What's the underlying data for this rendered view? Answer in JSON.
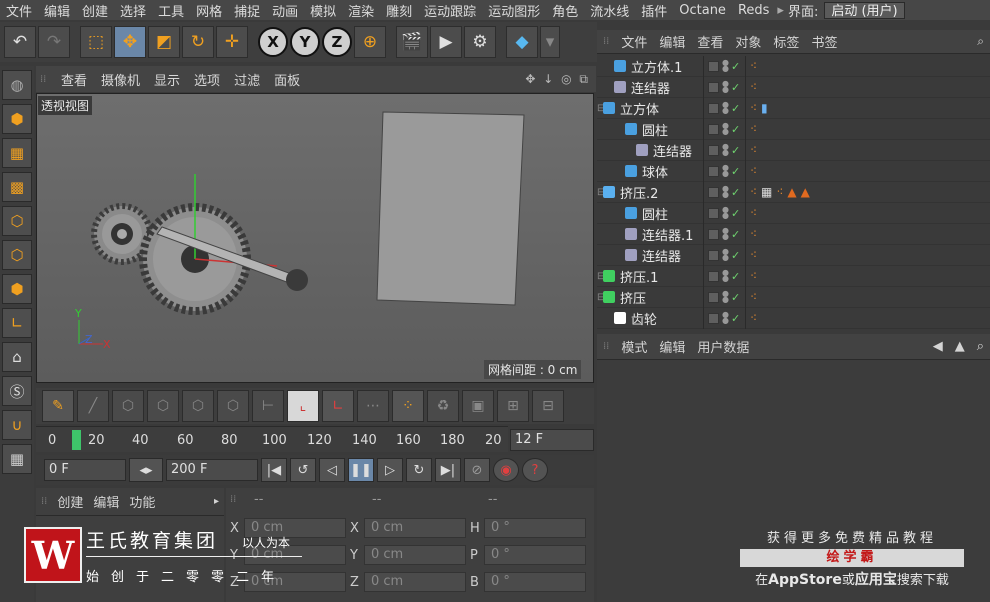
{
  "menubar": {
    "items": [
      "文件",
      "编辑",
      "创建",
      "选择",
      "工具",
      "网格",
      "捕捉",
      "动画",
      "模拟",
      "渲染",
      "雕刻",
      "运动跟踪",
      "运动图形",
      "角色",
      "流水线",
      "插件",
      "Octane",
      "Reds"
    ],
    "layout_label": "界面:",
    "layout_value": "启动 (用户)"
  },
  "toolbar": {
    "axis_x": "X",
    "axis_y": "Y",
    "axis_z": "Z"
  },
  "viewport": {
    "menu": [
      "查看",
      "摄像机",
      "显示",
      "选项",
      "过滤",
      "面板"
    ],
    "title": "透视视图",
    "grid_spacing": "网格间距 : 0 cm",
    "axis_y": "Y",
    "axis_z": "Z",
    "axis_x": "X"
  },
  "timeline": {
    "ticks": [
      "0",
      "20",
      "40",
      "60",
      "80",
      "100",
      "120",
      "140",
      "160",
      "180",
      "20"
    ],
    "current_frame": "12 F",
    "start_field": "0 F",
    "end_field": "200 F"
  },
  "materials": {
    "menu": [
      "创建",
      "编辑",
      "功能"
    ]
  },
  "coords": {
    "headers": [
      "--",
      "--",
      "--"
    ],
    "rows": [
      {
        "l1": "X",
        "v1": "0 cm",
        "l2": "X",
        "v2": "0 cm",
        "l3": "H",
        "v3": "0 °"
      },
      {
        "l1": "Y",
        "v1": "0 cm",
        "l2": "Y",
        "v2": "0 cm",
        "l3": "P",
        "v3": "0 °"
      },
      {
        "l1": "Z",
        "v1": "0 cm",
        "l2": "Z",
        "v2": "0 cm",
        "l3": "B",
        "v3": "0 °"
      }
    ]
  },
  "objects": {
    "menu": [
      "文件",
      "编辑",
      "查看",
      "对象",
      "标签",
      "书签"
    ],
    "rows": [
      {
        "name": "立方体.1",
        "color": "#4aa0e0",
        "indent": 1
      },
      {
        "name": "连结器",
        "color": "#a0a0c0",
        "indent": 1
      },
      {
        "name": "立方体",
        "color": "#4aa0e0",
        "indent": 0
      },
      {
        "name": "圆柱",
        "color": "#4aa0e0",
        "indent": 2
      },
      {
        "name": "连结器",
        "color": "#a0a0c0",
        "indent": 3
      },
      {
        "name": "球体",
        "color": "#4aa0e0",
        "indent": 2
      },
      {
        "name": "挤压.2",
        "color": "#5ab0f0",
        "indent": 0
      },
      {
        "name": "圆柱",
        "color": "#4aa0e0",
        "indent": 2
      },
      {
        "name": "连结器.1",
        "color": "#a0a0c0",
        "indent": 2
      },
      {
        "name": "连结器",
        "color": "#a0a0c0",
        "indent": 2
      },
      {
        "name": "挤压.1",
        "color": "#40d060",
        "indent": 0
      },
      {
        "name": "挤压",
        "color": "#40d060",
        "indent": 0
      },
      {
        "name": "齿轮",
        "color": "#ffffff",
        "indent": 1
      }
    ]
  },
  "attributes": {
    "menu": [
      "模式",
      "编辑",
      "用户数据"
    ]
  },
  "promo": {
    "top": "获得更多免费精品教程",
    "brand": "绘学霸",
    "bottom_pre": "在",
    "bottom_store": "AppStore",
    "bottom_mid": "或",
    "bottom_store2": "应用宝",
    "bottom_post": "搜索下载"
  },
  "watermark": {
    "logo_letter": "W",
    "name": "王氏教育集团",
    "slogan": "以人为本",
    "sub": "始创于二零零二年"
  },
  "colors": {
    "accent": "#f0a020",
    "selected": "#6a87a8",
    "brand_red": "#c0141a"
  }
}
